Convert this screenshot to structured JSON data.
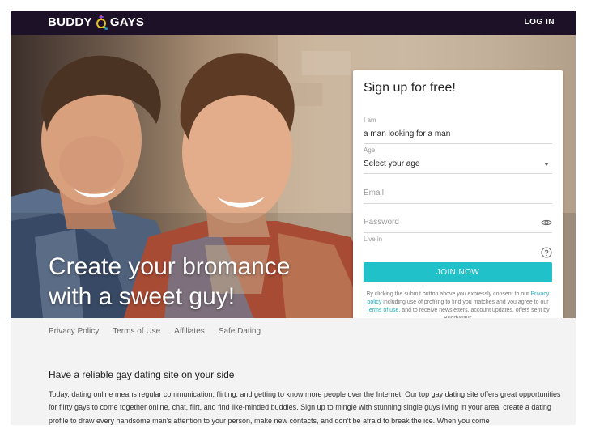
{
  "header": {
    "logo_left": "BUDDY",
    "logo_right": "GAYS",
    "login_label": "LOG IN"
  },
  "hero": {
    "headline_line1": "Create your bromance",
    "headline_line2": "with a sweet guy!"
  },
  "signup": {
    "title": "Sign up for free!",
    "iam_label": "I am",
    "iam_value": "a man looking for a man",
    "age_label": "Age",
    "age_value": "Select your age",
    "email_placeholder": "Email",
    "password_placeholder": "Password",
    "live_label": "Live in",
    "join_label": "JOIN NOW",
    "consent_1": "By clicking the submit button above you expressly consent to our",
    "privacy_link": "Privacy policy",
    "consent_2": "including use of profiling to find you matches and you agree to our",
    "terms_link": "Terms of use",
    "consent_3": ", and to receive newsletters, account updates, offers sent by Buddygays"
  },
  "footer_nav": [
    "Privacy Policy",
    "Terms of Use",
    "Affiliates",
    "Safe Dating"
  ],
  "seo": {
    "heading": "Have a reliable gay dating site on your side",
    "paragraph": "Today, dating online means regular communication, flirting, and getting to know more people over the Internet. Our top gay dating site offers great opportunities for flirty gays to come together online, chat, flirt, and find like-minded buddies. Sign up to mingle with stunning single guys living in your area, create a dating profile to draw every handsome man’s attention to your person, make new contacts, and don’t be afraid to break the ice. When you come"
  },
  "colors": {
    "topbar": "#1d1128",
    "accent": "#21c1c9",
    "link": "#21a9b5"
  }
}
